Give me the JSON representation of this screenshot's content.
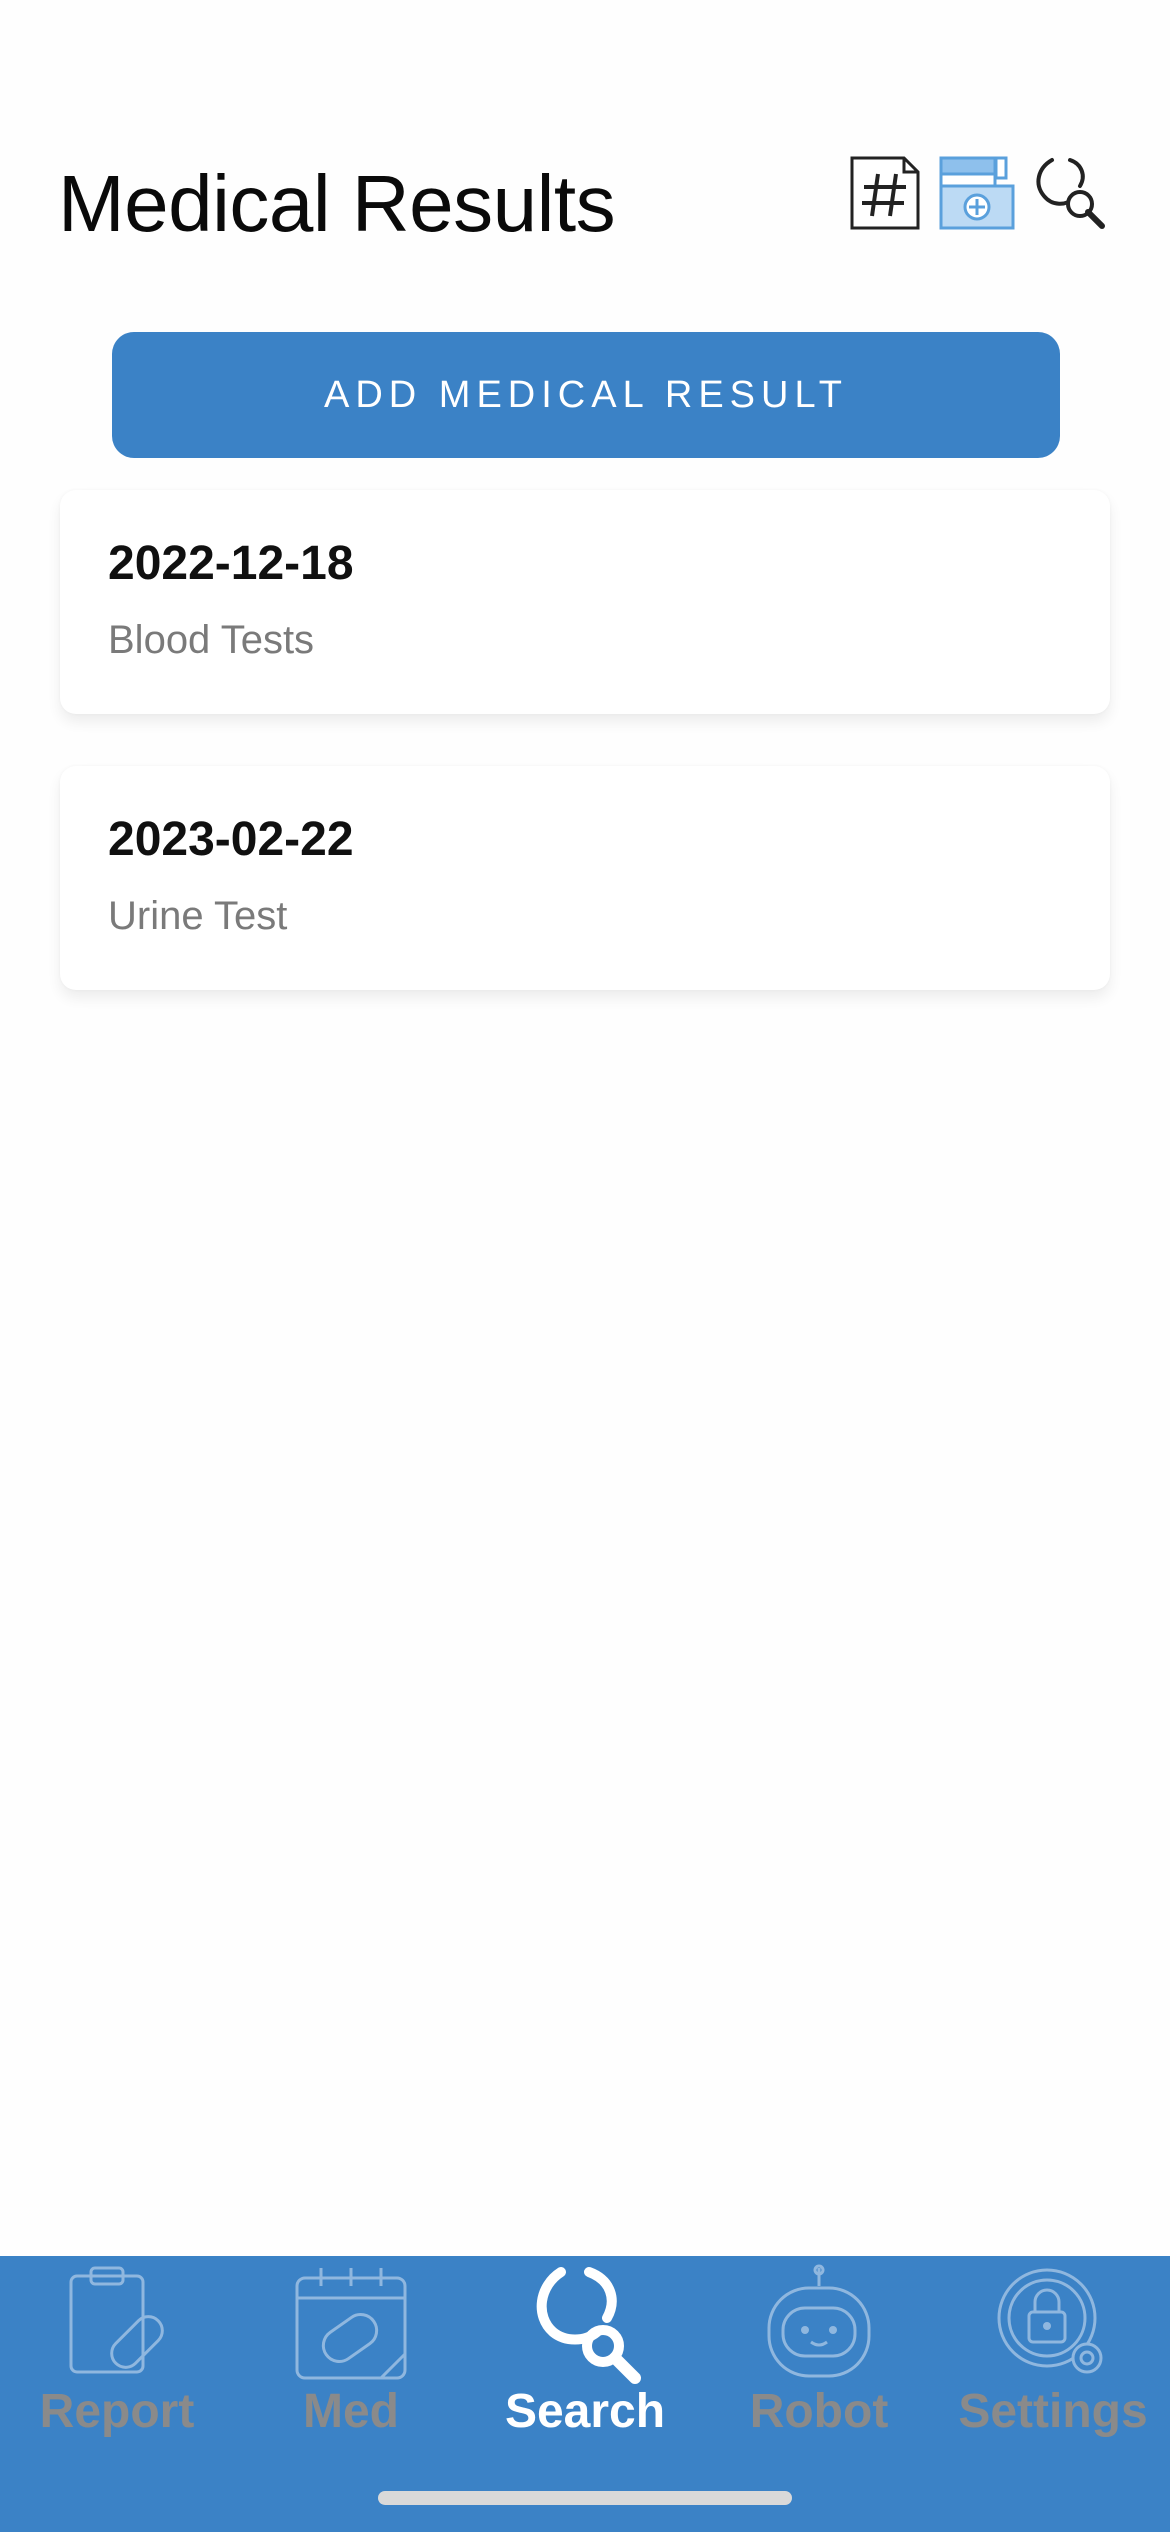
{
  "header": {
    "title": "Medical Results",
    "icons": [
      "hashtag-document-icon",
      "medical-kit-icon",
      "stethoscope-search-icon"
    ]
  },
  "actions": {
    "add_label": "ADD MEDICAL RESULT"
  },
  "results": [
    {
      "date": "2022-12-18",
      "type": "Blood Tests"
    },
    {
      "date": "2023-02-22",
      "type": "Urine Test"
    }
  ],
  "tabs": [
    {
      "label": "Report",
      "icon": "clipboard-pill-icon",
      "active": false
    },
    {
      "label": "Med",
      "icon": "calendar-pill-icon",
      "active": false
    },
    {
      "label": "Search",
      "icon": "stethoscope-icon",
      "active": true
    },
    {
      "label": "Robot",
      "icon": "robot-icon",
      "active": false
    },
    {
      "label": "Settings",
      "icon": "lock-gear-icon",
      "active": false
    }
  ],
  "colors": {
    "accent": "#3b82c6",
    "inactive_tab": "#8a8a8a",
    "active_tab": "#ffffff",
    "subtitle": "#7a7a7a"
  }
}
